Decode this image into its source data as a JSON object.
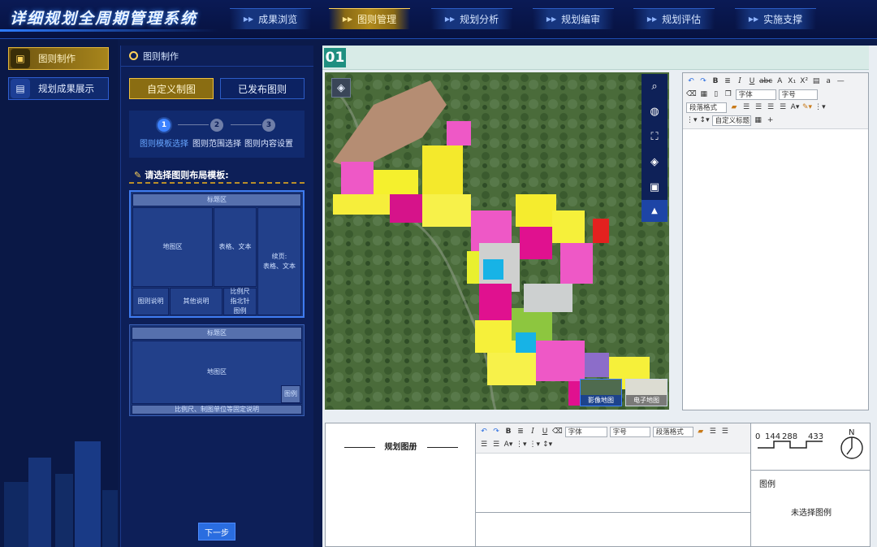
{
  "header": {
    "title": "详细规划全周期管理系统",
    "tabs": [
      {
        "label": "成果浏览",
        "active": false
      },
      {
        "label": "图则管理",
        "active": true
      },
      {
        "label": "规划分析",
        "active": false
      },
      {
        "label": "规划编审",
        "active": false
      },
      {
        "label": "规划评估",
        "active": false
      },
      {
        "label": "实施支撑",
        "active": false
      }
    ],
    "accent_color": "#f0c23f"
  },
  "leftnav": {
    "items": [
      {
        "label": "图则制作",
        "icon": "stamp-icon",
        "active": true
      },
      {
        "label": "规划成果展示",
        "icon": "document-icon",
        "active": false
      }
    ]
  },
  "config": {
    "panel_title": "图则制作",
    "mode_buttons": [
      {
        "label": "自定义制图",
        "active": true
      },
      {
        "label": "已发布图则",
        "active": false
      }
    ],
    "steps": [
      {
        "num": "1",
        "label": "图则模板选择",
        "active": true
      },
      {
        "num": "2",
        "label": "图则范围选择",
        "active": false
      },
      {
        "num": "3",
        "label": "图则内容设置",
        "active": false
      }
    ],
    "template_prompt": "请选择图则布局模板:",
    "template1": {
      "title": "标题区",
      "map": "地图区",
      "table": "表格、文本",
      "side": "续页:\n表格、文本",
      "legend": "图则说明",
      "other": "其他说明",
      "scale": "比例尺\n指北针\n图例"
    },
    "template2": {
      "title": "标题区",
      "map": "地图区",
      "legend": "图例",
      "footer": "比例尺、制图单位等固定说明"
    },
    "next_label": "下一步"
  },
  "workspace": {
    "page_number": "01",
    "basemaps": [
      {
        "label": "影像地图",
        "active": true
      },
      {
        "label": "电子地图",
        "active": false
      }
    ],
    "editor_font_placeholder": "字体",
    "editor_size_placeholder": "字号",
    "editor_para_placeholder": "段落格式",
    "editor_title_placeholder": "自定义标题",
    "atlas_title": "规划图册",
    "scale_labels": [
      "0",
      "144",
      "288",
      "433"
    ],
    "north_label": "N",
    "legend_title": "图例",
    "legend_empty": "未选择图例"
  }
}
